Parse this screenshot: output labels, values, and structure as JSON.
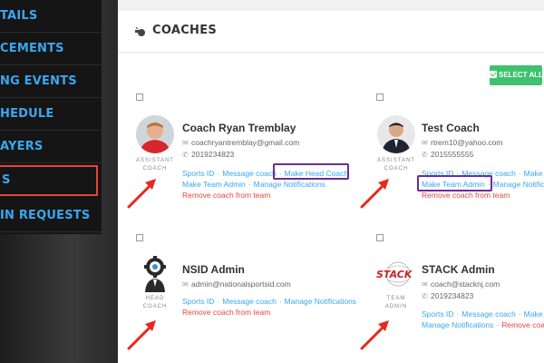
{
  "sidebar": {
    "items": [
      {
        "label": "TAILS"
      },
      {
        "label": "CEMENTS"
      },
      {
        "label": "NG EVENTS"
      },
      {
        "label": "HEDULE"
      },
      {
        "label": "AYERS"
      },
      {
        "label": "S"
      },
      {
        "label": "IN REQUESTS"
      }
    ]
  },
  "panel": {
    "title": "COACHES",
    "select_all": "SELECT ALL"
  },
  "coaches": [
    {
      "name": "Coach Ryan Tremblay",
      "role_line1": "ASSISTANT",
      "role_line2": "COACH",
      "email": "coachryantremblay@gmail.com",
      "phone": "2019234823",
      "links": [
        "Sports ID",
        "Message coach",
        "Make Head Coach",
        "Make Team Admin",
        "Manage Notifications"
      ],
      "remove": "Remove coach from team"
    },
    {
      "name": "Test Coach",
      "role_line1": "ASSISTANT",
      "role_line2": "COACH",
      "email": "rtrem10@yahoo.com",
      "phone": "2015555555",
      "links": [
        "Sports ID",
        "Message coach",
        "Make H",
        "Make Team Admin",
        "Manage Notifications"
      ],
      "remove": "Remove coach from team"
    },
    {
      "name": "NSID Admin",
      "role_line1": "HEAD",
      "role_line2": "COACH",
      "email": "admin@nationalsportsid.com",
      "phone": "",
      "links": [
        "Sports ID",
        "Message coach",
        "Manage Notifications"
      ],
      "remove": "Remove coach from team"
    },
    {
      "name": "STACK Admin",
      "role_line1": "TEAM",
      "role_line2": "ADMIN",
      "logo_text": "STACK",
      "email": "coach@stacknj.com",
      "phone": "2019234823",
      "links": [
        "Sports ID",
        "Message coach",
        "Make H",
        "Manage Notifications"
      ],
      "remove": "Remove coac"
    }
  ],
  "colors": {
    "accent_blue": "#39a7f0",
    "remove_red": "#e8453c",
    "highlight_purple": "#6b2d9c",
    "button_green": "#3ec26d",
    "arrow_red": "#e8281e"
  },
  "icons": {
    "header": "whistle-icon",
    "email": "envelope-icon",
    "phone": "phone-icon"
  }
}
